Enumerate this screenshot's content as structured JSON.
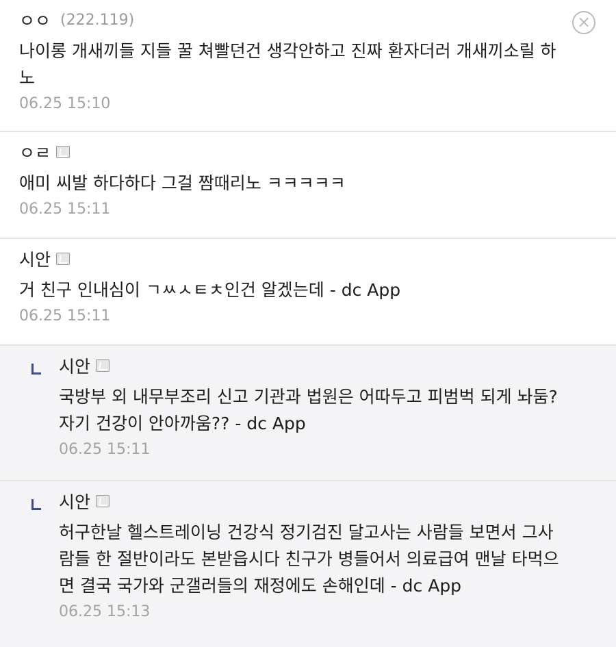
{
  "comments": [
    {
      "nick": "ㅇㅇ",
      "ip": "(222.119)",
      "body": "나이롱 개새끼들 지들 꿀 쳐빨던건 생각안하고 진짜 환자더러 개새끼소릴 하\n노",
      "time": "06.25 15:10",
      "close_icon": "close-icon"
    },
    {
      "nick": "ㅇㄹ",
      "body": "애미 씨발 하다하다 그걸 짬때리노 ㅋㅋㅋㅋㅋ",
      "time": "06.25 15:11",
      "mark_icon": "fixed-nick-icon"
    },
    {
      "nick": "시안",
      "body": "거 친구 인내심이 ㄱㅆㅅㅌㅊ인건 알겠는데 - dc App",
      "time": "06.25 15:11",
      "mark_icon": "fixed-nick-icon"
    },
    {
      "nick": "시안",
      "body": "국방부 외 내무부조리 신고 기관과 법원은 어따두고 피범벅 되게 놔둠?\n자기 건강이 안아까움?? - dc App",
      "time": "06.25 15:11",
      "reply_icon": "reply-arrow-icon"
    },
    {
      "nick": "시안",
      "body": "허구한날 헬스트레이닝 건강식 정기검진 달고사는 사람들 보면서 그사\n람들 한 절반이라도 본받읍시다 친구가 병들어서 의료급여 맨날 타먹으\n면 결국 국가와 군갤러들의 재정에도 손해인데 - dc App",
      "time": "06.25 15:13",
      "reply_icon": "reply-arrow-icon"
    }
  ],
  "colors": {
    "reply_bg": "#f4f4f6",
    "reply_arrow": "#3f4a8a",
    "timestamp": "#a2a2a2",
    "divider": "#e4e4e4"
  }
}
